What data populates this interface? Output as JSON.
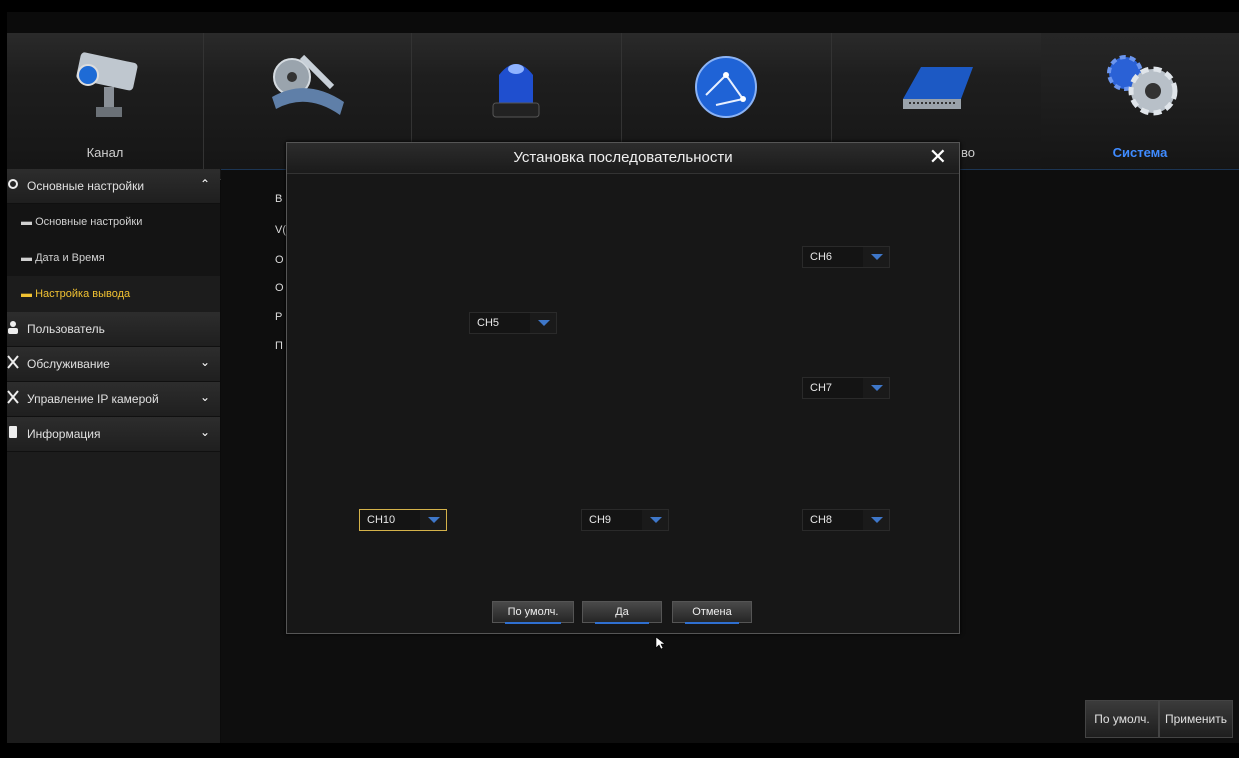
{
  "nav": {
    "tabs": [
      {
        "label": "Канал",
        "icon": "camera-icon"
      },
      {
        "label": "",
        "icon": "film-reel-icon"
      },
      {
        "label": "",
        "icon": "alarm-beacon-icon"
      },
      {
        "label": "",
        "icon": "network-globe-icon"
      },
      {
        "label": "во",
        "icon": "storage-device-icon"
      },
      {
        "label": "Система",
        "icon": "gears-icon"
      }
    ],
    "active_tab": "Система"
  },
  "sidebar": {
    "sections": [
      {
        "label": "Основные настройки",
        "icon": "gear-icon",
        "expanded": true,
        "children": [
          {
            "label": "Основные настройки"
          },
          {
            "label": "Дата и Время"
          },
          {
            "label": "Настройка вывода",
            "active": true
          }
        ]
      },
      {
        "label": "Пользователь",
        "icon": "user-icon"
      },
      {
        "label": "Обслуживание",
        "icon": "tools-icon",
        "expanded": false
      },
      {
        "label": "Управление IP камерой",
        "icon": "tools-icon",
        "expanded": false
      },
      {
        "label": "Информация",
        "icon": "info-icon",
        "expanded": false
      }
    ]
  },
  "content": {
    "partial_labels": [
      "В",
      "V(",
      "О",
      "О",
      "Р",
      "П"
    ],
    "default_button": "По умолч.",
    "apply_button": "Применить"
  },
  "dialog": {
    "title": "Установка последовательности",
    "channels": {
      "ch5": "CH5",
      "ch6": "CH6",
      "ch7": "CH7",
      "ch8": "CH8",
      "ch9": "CH9",
      "ch10": "CH10"
    },
    "buttons": {
      "default": "По умолч.",
      "ok": "Да",
      "cancel": "Отмена"
    }
  },
  "colors": {
    "accent": "#3f8bff",
    "active_submenu": "#f1c232",
    "focus_border": "#d4b24a"
  }
}
